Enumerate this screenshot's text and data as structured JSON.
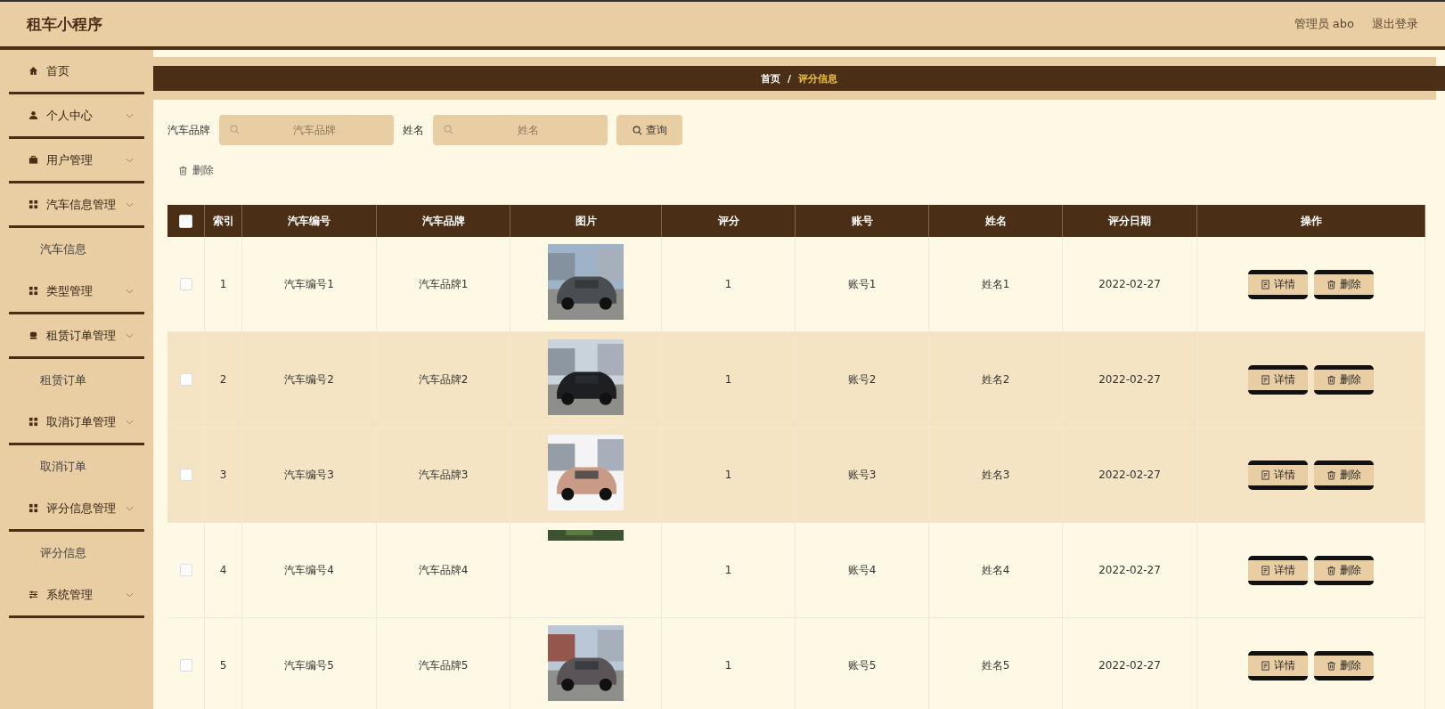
{
  "header": {
    "title": "租车小程序",
    "user": "管理员 abo",
    "logout": "退出登录"
  },
  "sidebar": {
    "items": [
      {
        "kind": "menu",
        "label": "首页",
        "expandable": false
      },
      {
        "kind": "menu",
        "label": "个人中心",
        "expandable": true
      },
      {
        "kind": "menu",
        "label": "用户管理",
        "expandable": true
      },
      {
        "kind": "menu",
        "label": "汽车信息管理",
        "expandable": true
      },
      {
        "kind": "sub",
        "label": "汽车信息"
      },
      {
        "kind": "menu",
        "label": "类型管理",
        "expandable": true
      },
      {
        "kind": "menu",
        "label": "租赁订单管理",
        "expandable": true
      },
      {
        "kind": "sub",
        "label": "租赁订单"
      },
      {
        "kind": "menu",
        "label": "取消订单管理",
        "expandable": true
      },
      {
        "kind": "sub",
        "label": "取消订单"
      },
      {
        "kind": "menu",
        "label": "评分信息管理",
        "expandable": true
      },
      {
        "kind": "sub",
        "label": "评分信息"
      },
      {
        "kind": "menu",
        "label": "系统管理",
        "expandable": true
      }
    ]
  },
  "breadcrumb_separator": "/",
  "breadcrumb": [
    {
      "label": "首页",
      "selected": false
    },
    {
      "label": "评分信息",
      "selected": true
    }
  ],
  "search": {
    "fields": [
      {
        "label": "汽车品牌",
        "placeholder": "汽车品牌"
      },
      {
        "label": "姓名",
        "placeholder": "姓名"
      }
    ],
    "button": "查询"
  },
  "bulk_delete": "删除",
  "table": {
    "select_all": false,
    "columns": [
      "索引",
      "汽车编号",
      "汽车品牌",
      "图片",
      "评分",
      "账号",
      "姓名",
      "评分日期",
      "操作"
    ],
    "rows": [
      {
        "checked": false,
        "highlighted": false,
        "index": "1",
        "car_no": "汽车编号1",
        "brand": "汽车品牌1",
        "image": {
          "kind": "picture",
          "partial": false
        },
        "score": "1",
        "account": "账号1",
        "name": "姓名1",
        "date": "2022-02-27",
        "actions": [
          "详情",
          "删除"
        ]
      },
      {
        "checked": false,
        "highlighted": true,
        "index": "2",
        "car_no": "汽车编号2",
        "brand": "汽车品牌2",
        "image": {
          "kind": "picture",
          "partial": false
        },
        "score": "1",
        "account": "账号2",
        "name": "姓名2",
        "date": "2022-02-27",
        "actions": [
          "详情",
          "删除"
        ]
      },
      {
        "checked": false,
        "highlighted": true,
        "index": "3",
        "car_no": "汽车编号3",
        "brand": "汽车品牌3",
        "image": {
          "kind": "picture",
          "partial": false
        },
        "score": "1",
        "account": "账号3",
        "name": "姓名3",
        "date": "2022-02-27",
        "actions": [
          "详情",
          "删除"
        ]
      },
      {
        "checked": false,
        "highlighted": false,
        "index": "4",
        "car_no": "汽车编号4",
        "brand": "汽车品牌4",
        "image": {
          "kind": "picture",
          "partial": true
        },
        "score": "1",
        "account": "账号4",
        "name": "姓名4",
        "date": "2022-02-27",
        "actions": [
          "详情",
          "删除"
        ]
      },
      {
        "checked": false,
        "highlighted": false,
        "index": "5",
        "car_no": "汽车编号5",
        "brand": "汽车品牌5",
        "image": {
          "kind": "picture",
          "partial": false
        },
        "score": "1",
        "account": "账号5",
        "name": "姓名5",
        "date": "2022-02-27",
        "actions": [
          "详情",
          "删除"
        ]
      }
    ]
  }
}
